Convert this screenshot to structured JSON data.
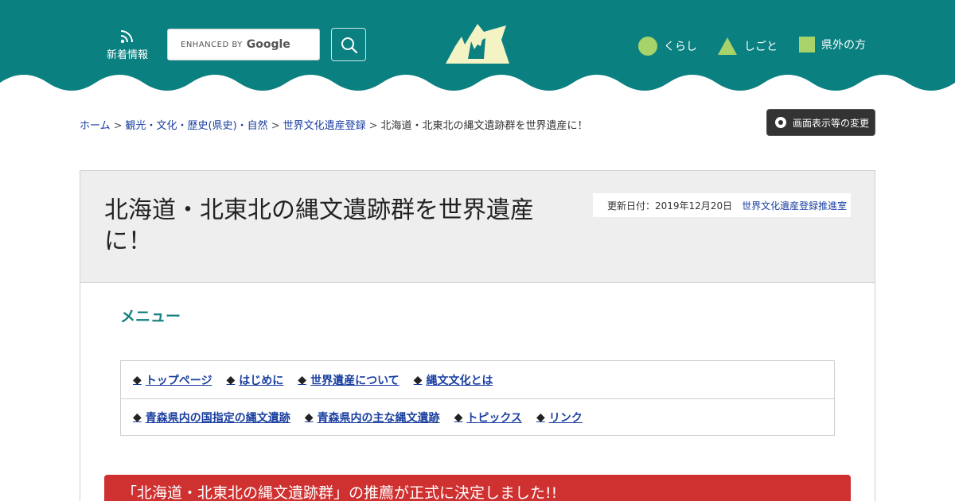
{
  "header": {
    "news_label": "新着情報",
    "search": {
      "enhanced_label": "ENHANCED BY",
      "google_label": "Google"
    },
    "nav": [
      {
        "label": "くらし",
        "color": "#a8d26a",
        "icon": "circle-icon"
      },
      {
        "label": "しごと",
        "color": "#a8d26a",
        "icon": "triangle-icon"
      },
      {
        "label": "県外の方",
        "color": "#a8d26a",
        "icon": "square-icon"
      }
    ],
    "bg_color": "#0b8080",
    "logo_color": "#f3f3c4"
  },
  "breadcrumb": {
    "items": [
      "ホーム",
      "観光・文化・歴史(県史)・自然",
      "世界文化遺産登録"
    ],
    "separator": ">",
    "current": "北海道・北東北の縄文遺跡群を世界遺産に！"
  },
  "display_button": {
    "label": "画面表示等の変更"
  },
  "page": {
    "title_line1": "北海道・北東北の縄文遺跡群を世界遺産",
    "title_line2": "に！",
    "updated": "更新日付：2019年12月20日",
    "department": "世界文化遺産登録推進室"
  },
  "menu": {
    "title": "メニュー",
    "marker": "◆",
    "row1": [
      "トップページ",
      "はじめに",
      "世界遺産について",
      "縄文文化とは"
    ],
    "row2": [
      "青森県内の国指定の縄文遺跡",
      "青森県内の主な縄文遺跡",
      "トピックス",
      "リンク"
    ]
  },
  "notice": {
    "text": "「北海道・北東北の縄文遺跡群」の推薦が正式に決定しました!!",
    "color": "#cf3030"
  }
}
